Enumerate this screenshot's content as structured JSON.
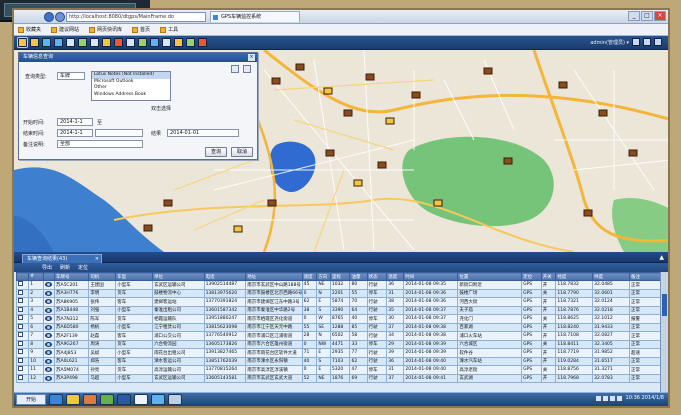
{
  "browser": {
    "address": "http://localhost:8080/dtgps/MainFrame.do",
    "tab_title": "GPS车辆监控系统",
    "window_controls": [
      "_",
      "□",
      "×"
    ]
  },
  "favorites": {
    "items": [
      "收藏夹",
      "建议网站",
      "网页快讯库",
      "首页",
      "工具"
    ]
  },
  "toolbar": {
    "user_info": "admin(管理员) ▾",
    "icons": [
      "select-icon",
      "pan-icon",
      "zoom-in-icon",
      "zoom-out-icon",
      "measure-icon",
      "track-icon",
      "area-icon",
      "vehicle-icon",
      "alarm-icon",
      "report-icon",
      "message-icon",
      "video-icon",
      "settings-icon",
      "layers-icon",
      "refresh-icon",
      "help-icon"
    ]
  },
  "dialog": {
    "title": "车辆信息查询",
    "close": "×",
    "label_query_type": "查询类型:",
    "query_type_value": "车牌",
    "list_options": [
      "Lotus Notes (Not Installed)",
      "Microsoft Outlook",
      "Other",
      "Windows Address Book"
    ],
    "list_selected_index": 0,
    "list_hint": "双击选择",
    "label_from": "开始时间:",
    "from_value": "2014-1-1",
    "from_sep": "至",
    "label_to": "结束时间:",
    "to_value": "2014-1-1",
    "to_right_label": "结果",
    "to_right_value": "2014-01-01",
    "label_remark": "备注说明:",
    "remark_value": "全部",
    "btn_ok": "查询",
    "btn_cancel": "取消"
  },
  "results": {
    "tab_title": "车辆查询结果(43)",
    "tab_close": "×",
    "collapse": "▲",
    "sub_items": [
      "导出",
      "刷新",
      "定位"
    ],
    "columns": [
      "",
      "#",
      "",
      "车牌号",
      "司机",
      "车型",
      "单位",
      "电话",
      "地址",
      "速度",
      "方向",
      "里程",
      "油量",
      "状态",
      "温度",
      "时间",
      "位置",
      "定位",
      "开关",
      "经度",
      "纬度",
      "备注"
    ],
    "rows": [
      [
        "",
        "1",
        "",
        "苏A5C201",
        "王建国",
        "小型车",
        "玄武区运输公司",
        "13902514487",
        "南京市玄武区中山路188号",
        "45",
        "NE",
        "1032",
        "80",
        "行驶",
        "36",
        "2014-01-08 09:35",
        "新街口附近",
        "GPS",
        "开",
        "118.7832",
        "32.0485",
        "正常"
      ],
      [
        "",
        "2",
        "",
        "苏A3H776",
        "李明",
        "货车",
        "鼓楼物流中心",
        "13813975620",
        "南京市鼓楼区北京西路66号",
        "0",
        "N",
        "2201",
        "55",
        "停车",
        "31",
        "2014-01-08 09:36",
        "鼓楼广场",
        "GPS",
        "关",
        "118.7790",
        "32.0601",
        "正常"
      ],
      [
        "",
        "3",
        "",
        "苏A8K905",
        "张伟",
        "客车",
        "建邺客运站",
        "13770391824",
        "南京市建邺区江东中路3号",
        "62",
        "E",
        "5874",
        "70",
        "行驶",
        "38",
        "2014-01-08 09:36",
        "河西大街",
        "GPS",
        "开",
        "118.7321",
        "32.0124",
        "正常"
      ],
      [
        "",
        "4",
        "",
        "苏A1B448",
        "刘强",
        "小型车",
        "秦淮出租公司",
        "13601587342",
        "南京市秦淮区中华路2号",
        "38",
        "S",
        "3390",
        "64",
        "行驶",
        "35",
        "2014-01-08 09:37",
        "夫子庙",
        "GPS",
        "开",
        "118.7876",
        "32.0218",
        "正常"
      ],
      [
        "",
        "5",
        "",
        "苏A7N312",
        "陈军",
        "货车",
        "栖霞运输队",
        "13951880247",
        "南京市栖霞区尧化街道",
        "0",
        "W",
        "8765",
        "40",
        "停车",
        "30",
        "2014-01-08 09:37",
        "尧化门",
        "GPS",
        "关",
        "118.8625",
        "32.1012",
        "报警"
      ],
      [
        "",
        "6",
        "",
        "苏A6D580",
        "杨帆",
        "小型车",
        "江宁租赁公司",
        "13815623098",
        "南京市江宁区天元中路",
        "55",
        "SE",
        "1288",
        "85",
        "行驶",
        "37",
        "2014-01-08 09:38",
        "百家湖",
        "GPS",
        "开",
        "118.8240",
        "31.9433",
        "正常"
      ],
      [
        "",
        "7",
        "",
        "苏A2F139",
        "赵磊",
        "客车",
        "浦口公交公司",
        "13776540912",
        "南京市浦口区江浦街道",
        "28",
        "N",
        "6502",
        "58",
        "行驶",
        "34",
        "2014-01-08 09:38",
        "浦口火车站",
        "GPS",
        "开",
        "118.7108",
        "32.0827",
        "正常"
      ],
      [
        "",
        "8",
        "",
        "苏A9G267",
        "周涛",
        "货车",
        "六合物流园",
        "13605173826",
        "南京市六合区雄州街道",
        "0",
        "NW",
        "4471",
        "33",
        "停车",
        "29",
        "2014-01-08 09:39",
        "六合城区",
        "GPS",
        "关",
        "118.8411",
        "32.3405",
        "正常"
      ],
      [
        "",
        "9",
        "",
        "苏A4J853",
        "吴斌",
        "小型车",
        "雨花台出租公司",
        "13913827465",
        "南京市雨花台区软件大道",
        "71",
        "E",
        "2935",
        "77",
        "行驶",
        "39",
        "2014-01-08 09:39",
        "软件谷",
        "GPS",
        "开",
        "118.7719",
        "31.9852",
        "超速"
      ],
      [
        "",
        "10",
        "",
        "苏A0L621",
        "郑浩",
        "客车",
        "溧水客运公司",
        "13851762039",
        "南京市溧水区永阳镇",
        "40",
        "S",
        "7103",
        "62",
        "行驶",
        "36",
        "2014-01-08 09:40",
        "溧水汽车站",
        "GPS",
        "开",
        "119.0284",
        "31.6517",
        "正常"
      ],
      [
        "",
        "11",
        "",
        "苏A5M074",
        "孙亮",
        "货车",
        "高淳运输公司",
        "13770815264",
        "南京市高淳区淳溪镇",
        "0",
        "E",
        "5320",
        "47",
        "停车",
        "31",
        "2014-01-08 09:40",
        "高淳老街",
        "GPS",
        "关",
        "118.8756",
        "31.3271",
        "正常"
      ],
      [
        "",
        "12",
        "",
        "苏A3P498",
        "马超",
        "小型车",
        "玄武区运输公司",
        "13605143581",
        "南京市玄武区玄武大道",
        "52",
        "NE",
        "1876",
        "69",
        "行驶",
        "37",
        "2014-01-08 09:41",
        "玄武湖",
        "GPS",
        "开",
        "118.7968",
        "32.0783",
        "正常"
      ]
    ]
  },
  "taskbar": {
    "start": "开始",
    "clock": "10:36 2014/1/8"
  },
  "colors": {
    "accent": "#2b4d84",
    "water": "#3f7fd0",
    "park": "#76c47a",
    "road": "#f3b53a"
  }
}
